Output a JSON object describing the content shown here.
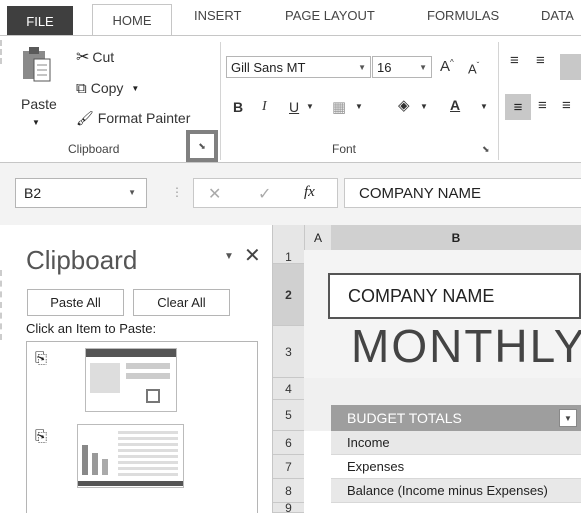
{
  "ribbon_tabs": {
    "file": "FILE",
    "home": "HOME",
    "insert": "INSERT",
    "page_layout": "PAGE LAYOUT",
    "formulas": "FORMULAS",
    "data": "DATA"
  },
  "clipboard_group": {
    "paste": "Paste",
    "cut": "Cut",
    "copy": "Copy",
    "format_painter": "Format Painter",
    "label": "Clipboard"
  },
  "font_group": {
    "font_name": "Gill Sans MT",
    "font_size": "16",
    "bold": "B",
    "italic": "I",
    "underline": "U",
    "label": "Font"
  },
  "formula_bar": {
    "name_box": "B2",
    "cancel": "✕",
    "enter": "✓",
    "fx": "fx",
    "content": "COMPANY NAME"
  },
  "clipboard_pane": {
    "title": "Clipboard",
    "paste_all": "Paste All",
    "clear_all": "Clear All",
    "instruction": "Click an Item to Paste:"
  },
  "sheet": {
    "col_a": "A",
    "col_b": "B",
    "rows": [
      "1",
      "2",
      "3",
      "4",
      "5",
      "6",
      "7",
      "8",
      "9"
    ],
    "company_name": "COMPANY NAME",
    "title": "MONTHLY",
    "budget_totals": "BUDGET TOTALS",
    "income": "Income",
    "expenses": "Expenses",
    "balance": "Balance (Income minus Expenses)"
  },
  "colors": {
    "file_tab": "#3f3f3f",
    "highlight_box": "#808080",
    "budget_header": "#9e9e9e",
    "row_fill": "#e8e8e8"
  }
}
